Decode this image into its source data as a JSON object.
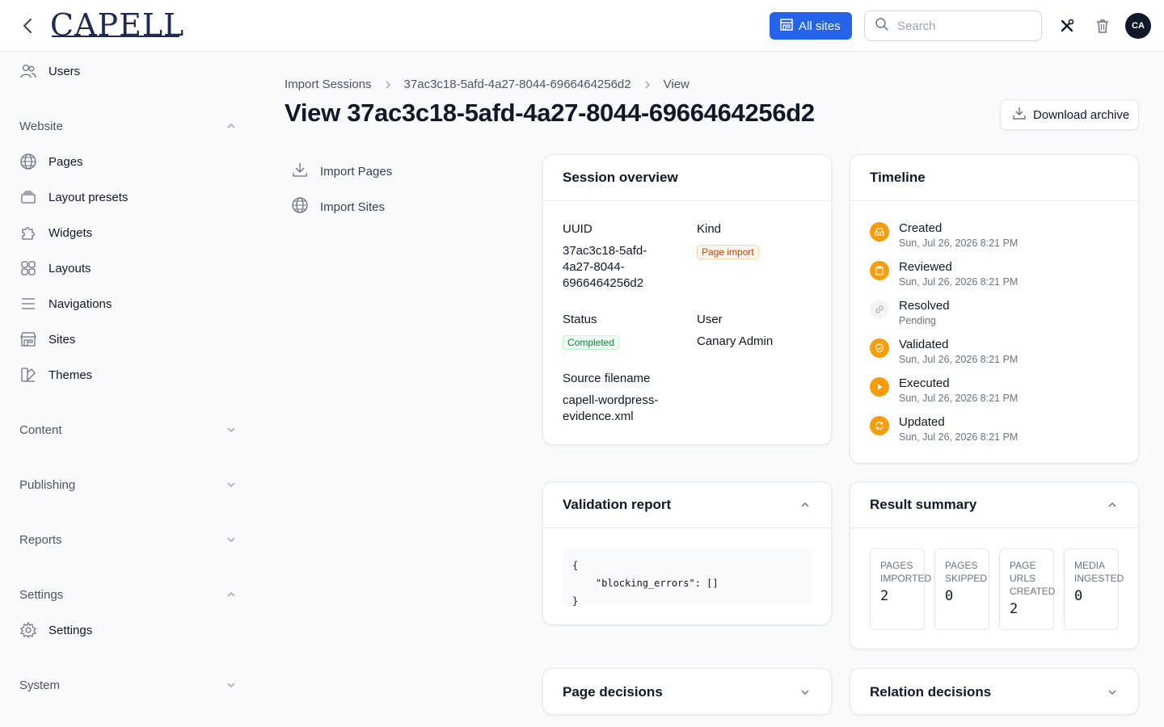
{
  "header": {
    "brand": "CAPELL",
    "all_sites_label": "All sites",
    "search_placeholder": "Search",
    "avatar_initials": "CA"
  },
  "sidebar": {
    "users_label": "Users",
    "groups": {
      "website": "Website",
      "content": "Content",
      "publishing": "Publishing",
      "reports": "Reports",
      "settings": "Settings",
      "system": "System"
    },
    "website_items": [
      "Pages",
      "Layout presets",
      "Widgets",
      "Layouts",
      "Navigations",
      "Sites",
      "Themes"
    ],
    "settings_items": [
      "Settings"
    ]
  },
  "breadcrumb": [
    "Import Sessions",
    "37ac3c18-5afd-4a27-8044-6966464256d2",
    "View"
  ],
  "page_title": "View 37ac3c18-5afd-4a27-8044-6966464256d2",
  "download_label": "Download archive",
  "subnav": [
    "Import Pages",
    "Import Sites"
  ],
  "session_overview": {
    "title": "Session overview",
    "uuid_label": "UUID",
    "uuid_lines": [
      "37ac3c18-5afd-",
      "4a27-8044-",
      "6966464256d2"
    ],
    "kind_label": "Kind",
    "kind_value": "Page import",
    "status_label": "Status",
    "status_value": "Completed",
    "user_label": "User",
    "user_value": "Canary Admin",
    "source_label": "Source filename",
    "source_lines": [
      "capell-wordpress-",
      "evidence.xml"
    ]
  },
  "timeline": {
    "title": "Timeline",
    "items": [
      {
        "title": "Created",
        "time": "Sun, Jul 26, 2026 8:21 PM"
      },
      {
        "title": "Reviewed",
        "time": "Sun, Jul 26, 2026 8:21 PM"
      },
      {
        "title": "Resolved",
        "time": "Pending"
      },
      {
        "title": "Validated",
        "time": "Sun, Jul 26, 2026 8:21 PM"
      },
      {
        "title": "Executed",
        "time": "Sun, Jul 26, 2026 8:21 PM"
      },
      {
        "title": "Updated",
        "time": "Sun, Jul 26, 2026 8:21 PM"
      }
    ]
  },
  "validation_report": {
    "title": "Validation report",
    "code": "{\n    \"blocking_errors\": []\n}"
  },
  "result_summary": {
    "title": "Result summary",
    "stats": [
      {
        "label": "PAGES\nIMPORTED",
        "value": "2"
      },
      {
        "label": "PAGES\nSKIPPED",
        "value": "0"
      },
      {
        "label": "PAGE\nURLS\nCREATED",
        "value": "2"
      },
      {
        "label": "MEDIA\nINGESTED",
        "value": "0"
      }
    ]
  },
  "page_decisions_title": "Page decisions",
  "relation_decisions_title": "Relation decisions"
}
